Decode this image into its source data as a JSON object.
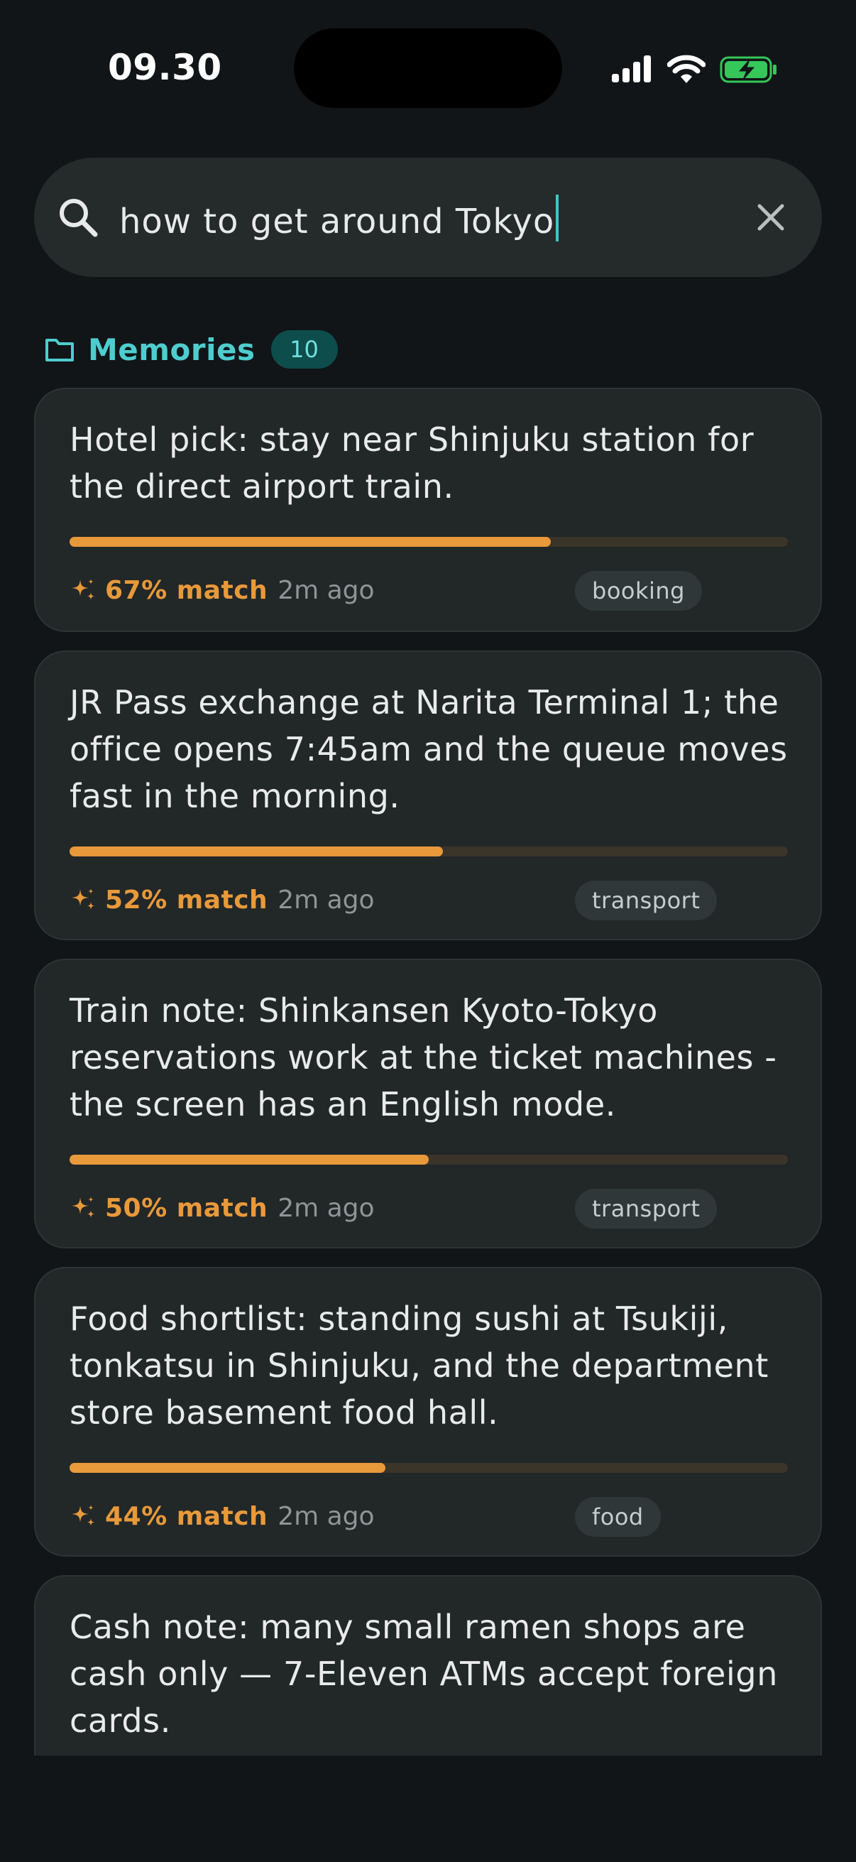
{
  "status_bar": {
    "time": "09.30",
    "icons": [
      "cellular-signal-icon",
      "wifi-icon",
      "battery-charging-icon"
    ]
  },
  "search": {
    "value": "how to get around Tokyo",
    "icon": "search-icon",
    "clear_icon": "close-icon"
  },
  "section": {
    "icon": "folder-icon",
    "title": "Memories",
    "count": "10"
  },
  "colors": {
    "background": "#111517",
    "accent_teal": "#4ecdcf",
    "match_orange": "#e8993a",
    "card": "#222728"
  },
  "memories": [
    {
      "text": "Hotel pick: stay near Shinjuku station for the direct airport train.",
      "match_percent": 67,
      "match_label": "67% match",
      "age": "2m ago",
      "tag": "booking"
    },
    {
      "text": "JR Pass exchange at Narita Terminal 1; the office opens 7:45am and the queue moves fast in the morning.",
      "match_percent": 52,
      "match_label": "52% match",
      "age": "2m ago",
      "tag": "transport"
    },
    {
      "text": "Train note: Shinkansen Kyoto-Tokyo reservations work at the ticket machines - the screen has an English mode.",
      "match_percent": 50,
      "match_label": "50% match",
      "age": "2m ago",
      "tag": "transport"
    },
    {
      "text": "Food shortlist: standing sushi at Tsukiji, tonkatsu in Shinjuku, and the department store basement food hall.",
      "match_percent": 44,
      "match_label": "44% match",
      "age": "2m ago",
      "tag": "food"
    },
    {
      "text": "Cash note: many small ramen shops are cash only — 7-Eleven ATMs accept foreign cards.",
      "match_percent": null,
      "match_label": "",
      "age": "",
      "tag": ""
    }
  ]
}
